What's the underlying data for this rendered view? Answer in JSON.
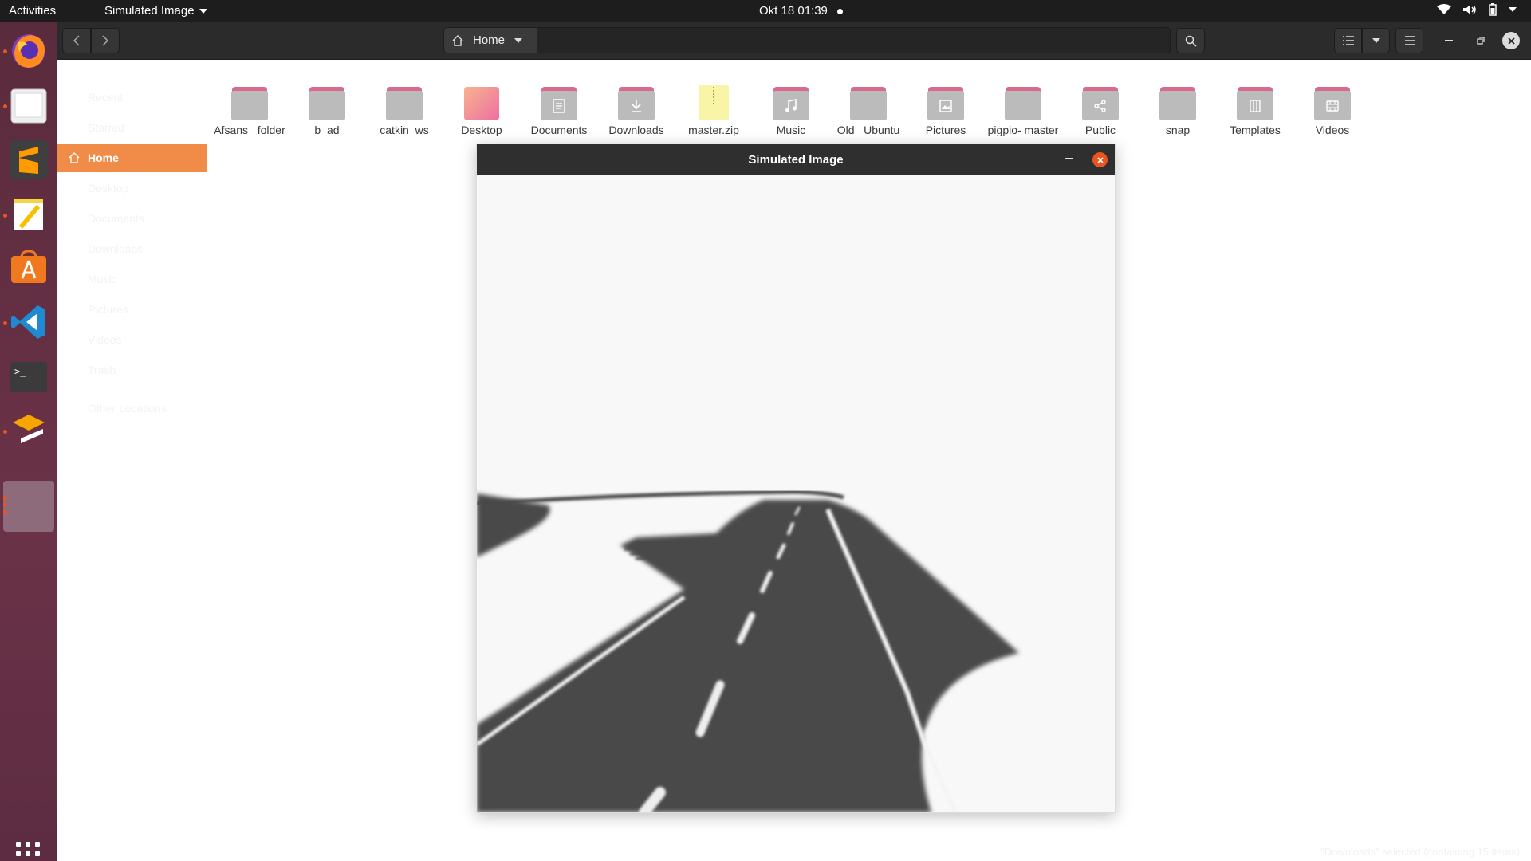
{
  "topbar": {
    "activities": "Activities",
    "app_name": "Simulated Image",
    "datetime": "Okt 18  01:39"
  },
  "file_manager": {
    "location": "Home",
    "sidebar": [
      {
        "label": "Recent"
      },
      {
        "label": "Starred"
      },
      {
        "label": "Home"
      },
      {
        "label": "Desktop"
      },
      {
        "label": "Documents"
      },
      {
        "label": "Downloads"
      },
      {
        "label": "Music"
      },
      {
        "label": "Pictures"
      },
      {
        "label": "Videos"
      },
      {
        "label": "Trash"
      },
      {
        "label": "Other Locations"
      }
    ],
    "files": [
      {
        "label": "Afsans_ folder",
        "icon": "folder-icon"
      },
      {
        "label": "b_ad",
        "icon": "folder-icon"
      },
      {
        "label": "catkin_ws",
        "icon": "folder-icon"
      },
      {
        "label": "Desktop",
        "icon": "desktop-folder-icon"
      },
      {
        "label": "Documents",
        "icon": "documents-folder-icon"
      },
      {
        "label": "Downloads",
        "icon": "downloads-folder-icon"
      },
      {
        "label": "master.zip",
        "icon": "zip-archive-icon"
      },
      {
        "label": "Music",
        "icon": "music-folder-icon"
      },
      {
        "label": "Old_ Ubuntu",
        "icon": "folder-icon"
      },
      {
        "label": "Pictures",
        "icon": "pictures-folder-icon"
      },
      {
        "label": "pigpio- master",
        "icon": "folder-icon"
      },
      {
        "label": "Public",
        "icon": "public-folder-icon"
      },
      {
        "label": "snap",
        "icon": "folder-icon"
      },
      {
        "label": "Templates",
        "icon": "templates-folder-icon"
      },
      {
        "label": "Videos",
        "icon": "videos-folder-icon"
      }
    ],
    "status": "\"Downloads\" selected  (containing 15 items)"
  },
  "viewer": {
    "title": "Simulated Image"
  },
  "colors": {
    "accent": "#e95420",
    "sidebar_active": "#f08b48",
    "road": "#4a4a4a"
  }
}
